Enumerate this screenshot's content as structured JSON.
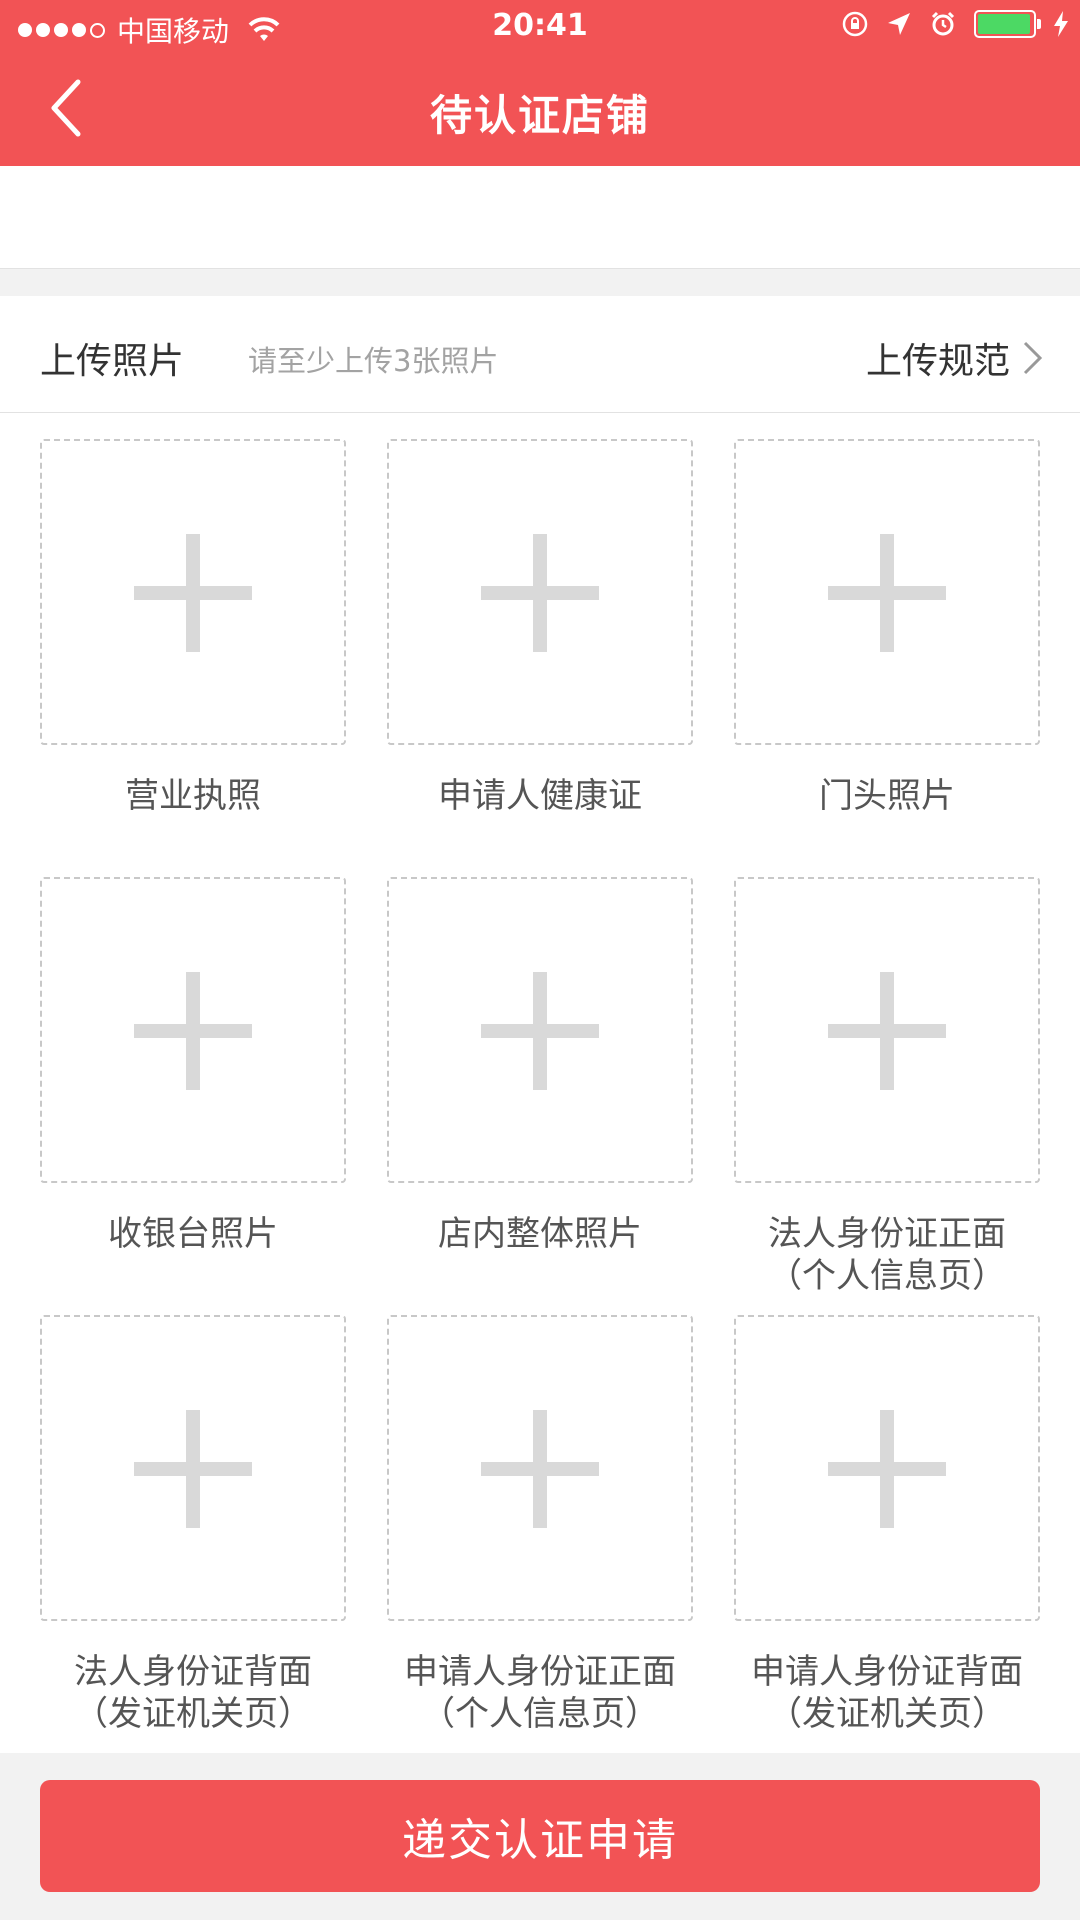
{
  "status_bar": {
    "carrier": "中国移动",
    "time": "20:41",
    "icons": [
      "wifi-icon",
      "rotation-lock-icon",
      "location-arrow-icon",
      "alarm-icon",
      "battery-icon",
      "charging-bolt-icon"
    ]
  },
  "header": {
    "title": "待认证店铺",
    "back_icon": "chevron-left-icon",
    "background_color": "#f25355"
  },
  "upload_section": {
    "title": "上传照片",
    "hint": "请至少上传3张照片",
    "spec_link": "上传规范",
    "spec_icon": "chevron-right-icon"
  },
  "photo_slots": [
    {
      "label_line1": "营业执照",
      "label_line2": ""
    },
    {
      "label_line1": "申请人健康证",
      "label_line2": ""
    },
    {
      "label_line1": "门头照片",
      "label_line2": ""
    },
    {
      "label_line1": "收银台照片",
      "label_line2": ""
    },
    {
      "label_line1": "店内整体照片",
      "label_line2": ""
    },
    {
      "label_line1": "法人身份证正面",
      "label_line2": "（个人信息页）"
    },
    {
      "label_line1": "法人身份证背面",
      "label_line2": "（发证机关页）"
    },
    {
      "label_line1": "申请人身份证正面",
      "label_line2": "（个人信息页）"
    },
    {
      "label_line1": "申请人身份证背面",
      "label_line2": "（发证机关页）"
    }
  ],
  "submit_button": {
    "label": "递交认证申请"
  }
}
